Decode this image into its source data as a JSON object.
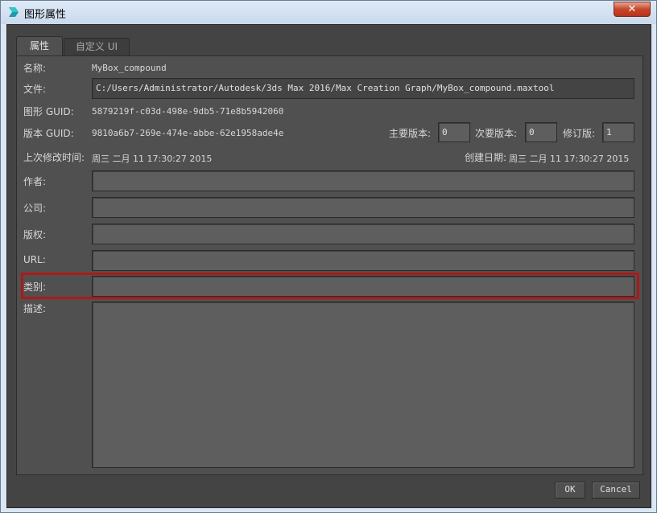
{
  "window": {
    "title": "图形属性",
    "close_label": "✕"
  },
  "tabs": [
    {
      "label": "属性",
      "active": true
    },
    {
      "label": "自定义 UI",
      "active": false
    }
  ],
  "properties": {
    "name_label": "名称:",
    "name_value": "MyBox_compound",
    "file_label": "文件:",
    "file_value": "C:/Users/Administrator/Autodesk/3ds Max 2016/Max Creation Graph/MyBox_compound.maxtool",
    "graph_guid_label": "图形 GUID:",
    "graph_guid_value": "5879219f-c03d-498e-9db5-71e8b5942060",
    "version_guid_label": "版本 GUID:",
    "version_guid_value": "9810a6b7-269e-474e-abbe-62e1958ade4e",
    "major_version_label": "主要版本:",
    "major_version_value": "0",
    "minor_version_label": "次要版本:",
    "minor_version_value": "0",
    "revision_label": "修订版:",
    "revision_value": "1",
    "last_modified_label": "上次修改时间:",
    "last_modified_value": "周三 二月 11 17:30:27 2015",
    "created_label": "创建日期:",
    "created_value": "周三 二月 11 17:30:27 2015",
    "author_label": "作者:",
    "author_value": "",
    "company_label": "公司:",
    "company_value": "",
    "copyright_label": "版权:",
    "copyright_value": "",
    "url_label": "URL:",
    "url_value": "",
    "category_label": "类别:",
    "category_value": "",
    "description_label": "描述:",
    "description_value": ""
  },
  "buttons": {
    "ok_label": "OK",
    "cancel_label": "Cancel"
  },
  "colors": {
    "highlight": "#b01818",
    "panel_bg": "#505050"
  }
}
